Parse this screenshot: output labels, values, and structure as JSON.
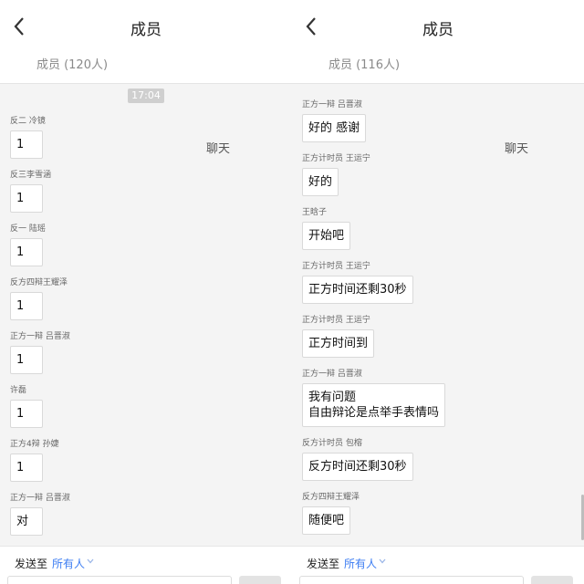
{
  "left": {
    "title": "成员",
    "tab_members": "成员 (120人)",
    "tab_chat": "聊天",
    "time": "17:04",
    "messages": [
      {
        "sender": "反二 冷镜",
        "text": "1"
      },
      {
        "sender": "反三李雪涵",
        "text": "1"
      },
      {
        "sender": "反一 陆瑶",
        "text": "1"
      },
      {
        "sender": "反方四辩王耀泽",
        "text": "1"
      },
      {
        "sender": "正方一辩 吕晋淑",
        "text": "1"
      },
      {
        "sender": "许磊",
        "text": "1"
      },
      {
        "sender": "正方4辩 孙婕",
        "text": "1"
      },
      {
        "sender": "正方一辩 吕晋淑",
        "text": "对"
      }
    ],
    "send_to_label": "发送至",
    "send_to_value": "所有人"
  },
  "right": {
    "title": "成员",
    "tab_members": "成员 (116人)",
    "tab_chat": "聊天",
    "messages": [
      {
        "sender": "正方一辩 吕晋淑",
        "text": "好的 感谢"
      },
      {
        "sender": "正方计时员 王运宁",
        "text": "好的"
      },
      {
        "sender": "王晗子",
        "text": "开始吧"
      },
      {
        "sender": "正方计时员 王运宁",
        "text": "正方时间还剩30秒"
      },
      {
        "sender": "正方计时员 王运宁",
        "text": "正方时间到"
      },
      {
        "sender": "正方一辩 吕晋淑",
        "text_line1": "我有问题",
        "text_line2": "自由辩论是点举手表情吗"
      },
      {
        "sender": "反方计时员 包榕",
        "text": "反方时间还剩30秒"
      },
      {
        "sender": "反方四辩王耀泽",
        "text": "随便吧"
      }
    ],
    "send_to_label": "发送至",
    "send_to_value": "所有人"
  },
  "colors": {
    "accent": "#3b7cf2",
    "background": "#f4f4f4"
  },
  "icons": {
    "back": "chevron-left-icon",
    "dropdown": "chevron-down-icon"
  }
}
